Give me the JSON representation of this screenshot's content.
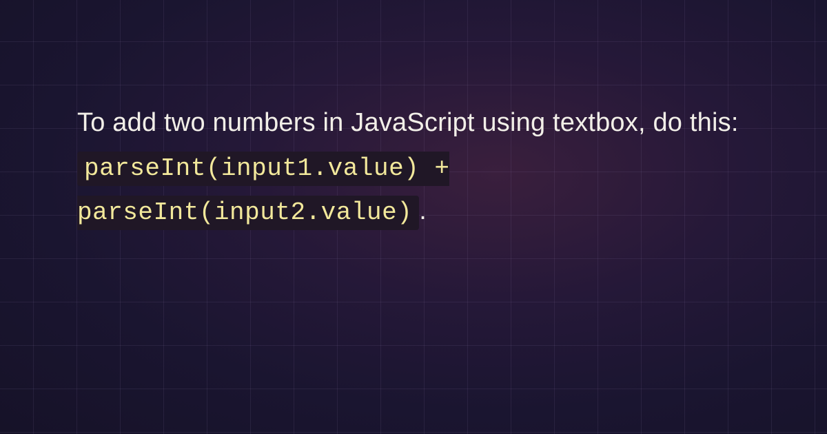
{
  "content": {
    "intro_text": "To add two numbers in JavaScript using textbox, do this: ",
    "code_snippet": "parseInt(input1.value) + parseInt(input2.value)",
    "trailing_text": "."
  }
}
